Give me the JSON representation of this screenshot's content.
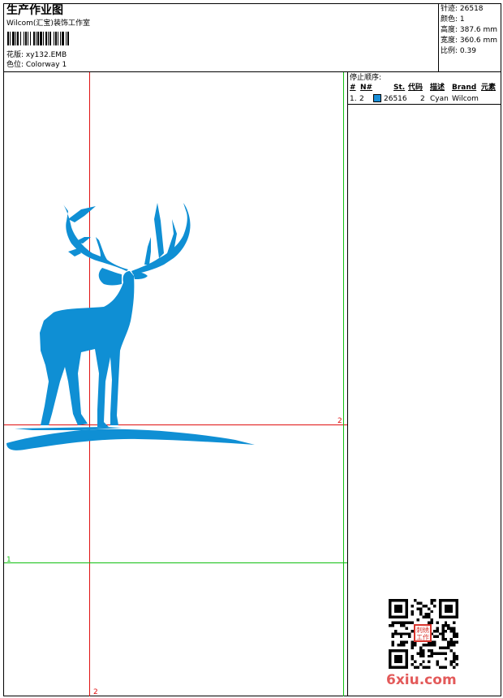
{
  "header": {
    "title": "生产作业图",
    "company": "Wilcom(汇宝)装饰工作室",
    "design": "花版: xy132.EMB",
    "colorway": "色位: Colorway 1"
  },
  "stats": {
    "stitches": "针迹: 26518",
    "colors": "颜色: 1",
    "height": "高度: 387.6 mm",
    "width": "宽度: 360.6 mm",
    "scale": "比例: 0.39"
  },
  "sequence": {
    "title": "停止顺序:",
    "columns": [
      "#",
      "N#",
      "St.",
      "代码",
      "描述",
      "Brand",
      "元素"
    ],
    "rows": [
      {
        "index": "1.",
        "needle": "2",
        "swatch_color": "#1a8fd8",
        "stitches": "26516",
        "code": "2",
        "description": "Cyan",
        "brand": "Wilcom",
        "element": ""
      }
    ]
  },
  "guides": {
    "red_h_label": "2",
    "red_v_label": "2",
    "green_h_label": "1"
  },
  "design_color": "#0f8fd4",
  "watermark": "6xiu.com",
  "stamp_text": [
    "刺绣",
    "工作"
  ]
}
